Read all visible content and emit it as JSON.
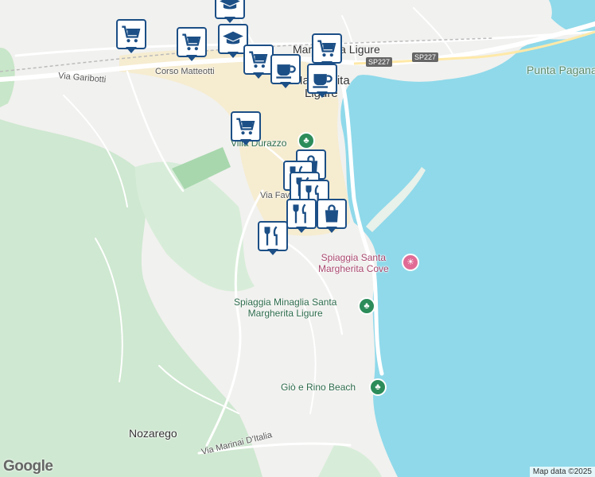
{
  "map": {
    "colors": {
      "land": "#f1f1ef",
      "water": "#8fd9ea",
      "park": "#c8e6c9",
      "park_dark": "#a8d7ad",
      "road": "#ffffff",
      "town": "#f5e9c8",
      "marker_border": "#1c4f86",
      "poi_green": "#2c8c5a",
      "poi_pink": "#e06b95"
    },
    "labels": {
      "corso_matteotti": "Corso Matteotti",
      "via_garibotti": "Via Garibotti",
      "santa_margherita": "Santa Margherita Ligure",
      "santa_margherita_short": "Margherita Ligure",
      "villa_durazzo": "Villa Durazzo",
      "via_favale": "Via Fava",
      "punta_pagana": "Punta Pagana",
      "spiaggia_santa_cove_1": "Spiaggia Santa",
      "spiaggia_santa_cove_2": "Margherita Cove",
      "spiaggia_minaglia_1": "Spiaggia Minaglia Santa",
      "spiaggia_minaglia_2": "Margherita Ligure",
      "gio_rino": "Giò e Rino Beach",
      "nozarego": "Nozarego",
      "via_marinai": "Via Marinai D'Italia",
      "sp227_a": "SP227",
      "sp227_b": "SP227",
      "town_line1": "Santa",
      "town_line2": "Margherita",
      "town_line3": "Ligure"
    },
    "attribution": {
      "logo": "Google",
      "text": "Map data ©2025"
    },
    "markers": [
      {
        "icon": "cart-icon"
      },
      {
        "icon": "cart-icon"
      },
      {
        "icon": "school-icon"
      },
      {
        "icon": "school-icon"
      },
      {
        "icon": "cart-icon"
      },
      {
        "icon": "cart-icon"
      },
      {
        "icon": "cafe-icon"
      },
      {
        "icon": "cafe-icon"
      },
      {
        "icon": "cart-icon"
      },
      {
        "icon": "bag-icon"
      },
      {
        "icon": "restaurant-icon"
      },
      {
        "icon": "restaurant-icon"
      },
      {
        "icon": "bag-icon"
      },
      {
        "icon": "restaurant-icon"
      }
    ]
  }
}
